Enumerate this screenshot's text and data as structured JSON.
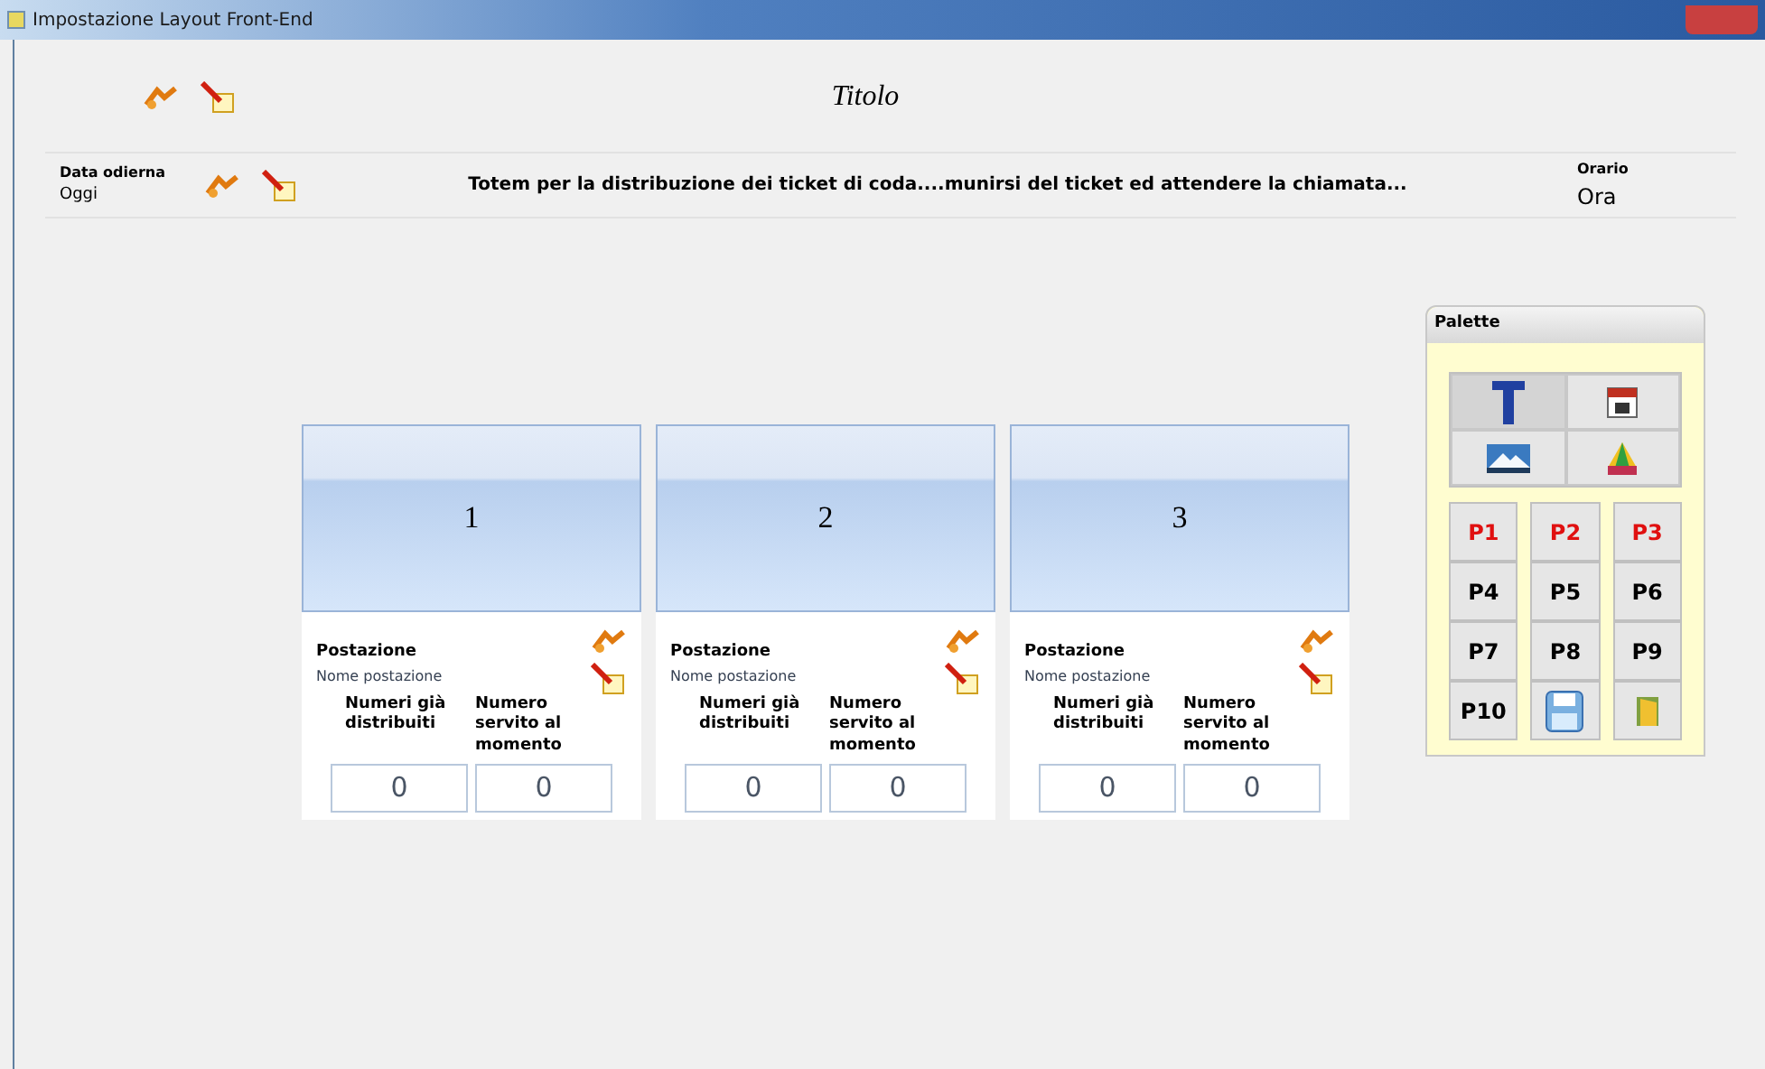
{
  "window": {
    "title": "Impostazione Layout Front-End"
  },
  "header": {
    "title": "Titolo"
  },
  "info_bar": {
    "date_label": "Data odierna",
    "date_value": "Oggi",
    "message": "Totem per la distribuzione dei ticket di coda....munirsi del ticket ed attendere la chiamata...",
    "time_label": "Orario",
    "time_value": "Ora"
  },
  "stations": [
    {
      "number": "1",
      "label": "Postazione",
      "name": "Nome postazione",
      "distributed_label": "Numeri già distribuiti",
      "served_label": "Numero servito al momento",
      "distributed": "0",
      "served": "0"
    },
    {
      "number": "2",
      "label": "Postazione",
      "name": "Nome postazione",
      "distributed_label": "Numeri già distribuiti",
      "served_label": "Numero servito al momento",
      "distributed": "0",
      "served": "0"
    },
    {
      "number": "3",
      "label": "Postazione",
      "name": "Nome postazione",
      "distributed_label": "Numeri già distribuiti",
      "served_label": "Numero servito al momento",
      "distributed": "0",
      "served": "0"
    }
  ],
  "palette": {
    "title": "Palette",
    "tools": [
      {
        "kind": "text",
        "selected": true
      },
      {
        "kind": "calendar",
        "selected": false
      },
      {
        "kind": "image",
        "selected": false
      },
      {
        "kind": "colors",
        "selected": false
      }
    ],
    "buttons": [
      {
        "kind": "station",
        "label": "P1",
        "used": true
      },
      {
        "kind": "station",
        "label": "P2",
        "used": true
      },
      {
        "kind": "station",
        "label": "P3",
        "used": true
      },
      {
        "kind": "station",
        "label": "P4",
        "used": false
      },
      {
        "kind": "station",
        "label": "P5",
        "used": false
      },
      {
        "kind": "station",
        "label": "P6",
        "used": false
      },
      {
        "kind": "station",
        "label": "P7",
        "used": false
      },
      {
        "kind": "station",
        "label": "P8",
        "used": false
      },
      {
        "kind": "station",
        "label": "P9",
        "used": false
      },
      {
        "kind": "station",
        "label": "P10",
        "used": false
      },
      {
        "kind": "save"
      },
      {
        "kind": "exit"
      }
    ]
  }
}
